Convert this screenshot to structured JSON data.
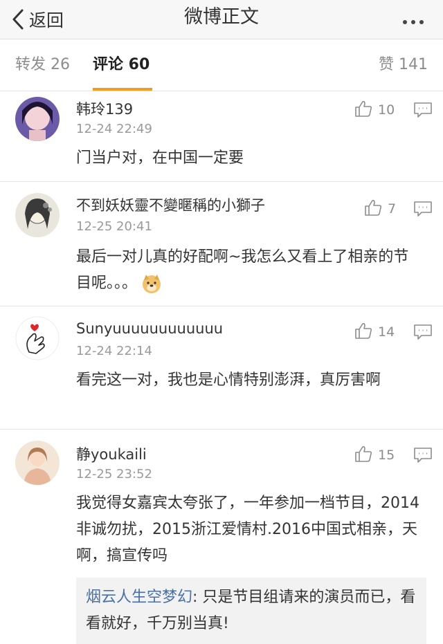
{
  "header": {
    "back_label": "返回",
    "title": "微博正文"
  },
  "tabs": {
    "repost": "转发 26",
    "comment": "评论 60",
    "like": "赞 141"
  },
  "comments": [
    {
      "name": "韩玲139",
      "time": "12-24 22:49",
      "likes": "10",
      "text": "门当户对，在中国一定要"
    },
    {
      "name": "不到妖妖靈不變暱稱的小獅子",
      "time": "12-25 20:41",
      "likes": "7",
      "text": "最后一对儿真的好配啊~我怎么又看上了相亲的节目呢。。。"
    },
    {
      "name": "Sunyuuuuuuuuuuuu",
      "time": "12-24 22:14",
      "likes": "14",
      "text": "看完这一对，我也是心情特别澎湃，真厉害啊"
    },
    {
      "name": "静youkaili",
      "time": "12-25 23:52",
      "likes": "15",
      "text": "我觉得女嘉宾太夸张了，一年参加一档节目，2014非诚勿扰，2015浙江爱情村.2016中国式相亲，天啊，搞宣传吗",
      "quote": {
        "user": "烟云人生空梦幻",
        "text": ": 只是节目组请来的演员而已，看看就好，千万别当真!"
      }
    }
  ],
  "colors": {
    "accent": "#f29c1f",
    "link": "#4a6fa5"
  }
}
